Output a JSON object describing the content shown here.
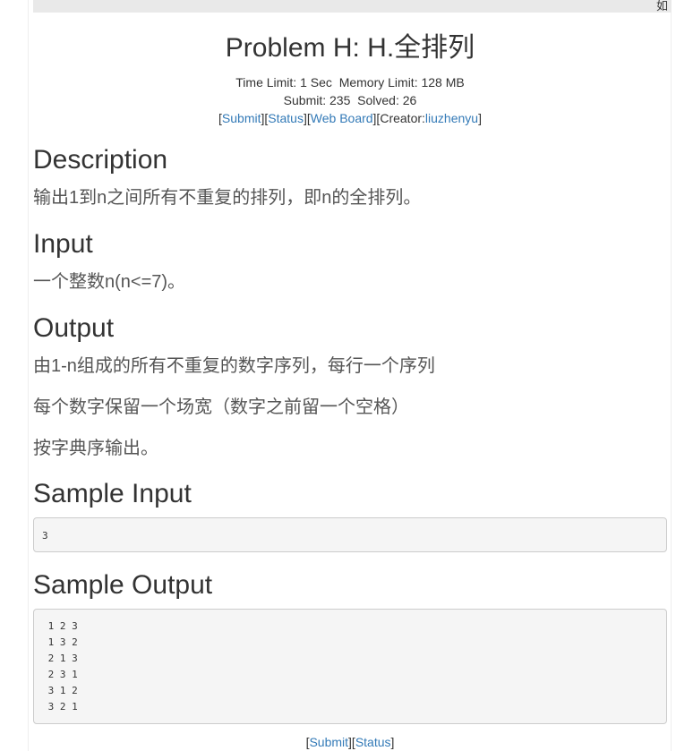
{
  "top_strip_text": "如",
  "problem": {
    "title": "Problem H: H.全排列",
    "time_limit_label": "Time Limit:",
    "time_limit": "1 Sec",
    "memory_limit_label": "Memory Limit:",
    "memory_limit": "128 MB",
    "submit_label": "Submit:",
    "submit_count": "235",
    "solved_label": "Solved:",
    "solved_count": "26"
  },
  "nav": {
    "submit": "Submit",
    "status": "Status",
    "web_board": "Web Board",
    "creator_label": "Creator:",
    "creator": "liuzhenyu"
  },
  "sections": {
    "description_heading": "Description",
    "description_text": "输出1到n之间所有不重复的排列，即n的全排列。",
    "input_heading": "Input",
    "input_text": "一个整数n(n<=7)。",
    "output_heading": "Output",
    "output_lines": [
      "由1-n组成的所有不重复的数字序列，每行一个序列",
      "每个数字保留一个场宽（数字之前留一个空格）",
      "按字典序输出。"
    ],
    "sample_input_heading": "Sample Input",
    "sample_input_lines": [
      "3"
    ],
    "sample_output_heading": "Sample Output",
    "sample_output_lines": [
      " 1 2 3",
      " 1 3 2",
      " 2 1 3",
      " 2 3 1",
      " 3 1 2",
      " 3 2 1"
    ]
  },
  "bottom_nav": {
    "submit": "Submit",
    "status": "Status"
  }
}
